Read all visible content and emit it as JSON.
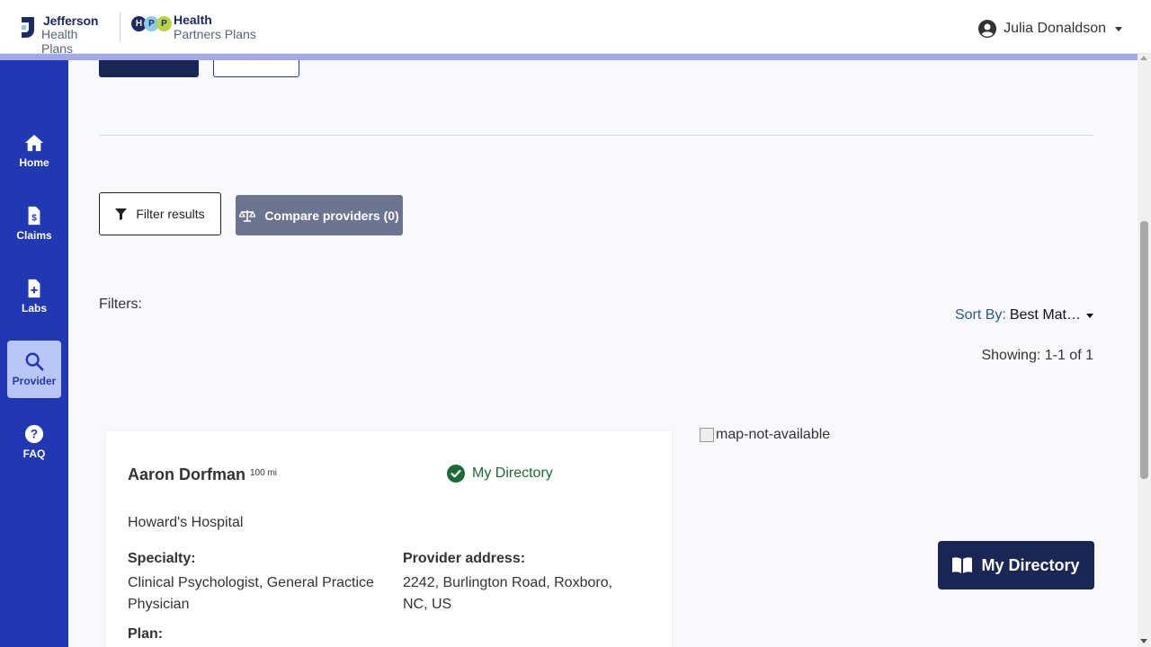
{
  "header": {
    "logo_jefferson_line1": "Jefferson",
    "logo_jefferson_line2": "Health Plans",
    "logo_hpp_dots": [
      "H",
      "P",
      "P"
    ],
    "logo_hpp_line1": "Health",
    "logo_hpp_line2": "Partners Plans",
    "user_name": "Julia Donaldson"
  },
  "sidebar": {
    "items": [
      {
        "label": "Home",
        "icon": "home-icon",
        "active": false
      },
      {
        "label": "Claims",
        "icon": "claims-icon",
        "active": false
      },
      {
        "label": "Labs",
        "icon": "labs-icon",
        "active": false
      },
      {
        "label": "Provider",
        "icon": "search-icon",
        "active": true
      },
      {
        "label": "FAQ",
        "icon": "help-icon",
        "active": false
      }
    ]
  },
  "main": {
    "filter_button": "Filter results",
    "compare_button": "Compare providers (0)",
    "filters_label": "Filters:",
    "sort_by_label": "Sort By:",
    "sort_by_value": "Best Mat…",
    "showing": "Showing: 1-1 of 1",
    "map_alt": "map-not-available",
    "my_directory_button": "My Directory"
  },
  "provider_card": {
    "name": "Aaron Dorfman",
    "distance": "100 mi",
    "status": "My Directory",
    "hospital": "Howard's Hospital",
    "specialty_label": "Specialty:",
    "specialty_value": "Clinical Psychologist, General Practice Physician",
    "address_label": "Provider address:",
    "address_value": "2242, Burlington Road, Roxboro, NC, US",
    "plan_label": "Plan:"
  },
  "colors": {
    "sidebar_bg": "#2138b3",
    "primary_dark": "#1a2654",
    "compare_bg": "#6c7590",
    "status_green": "#1a6b34"
  }
}
